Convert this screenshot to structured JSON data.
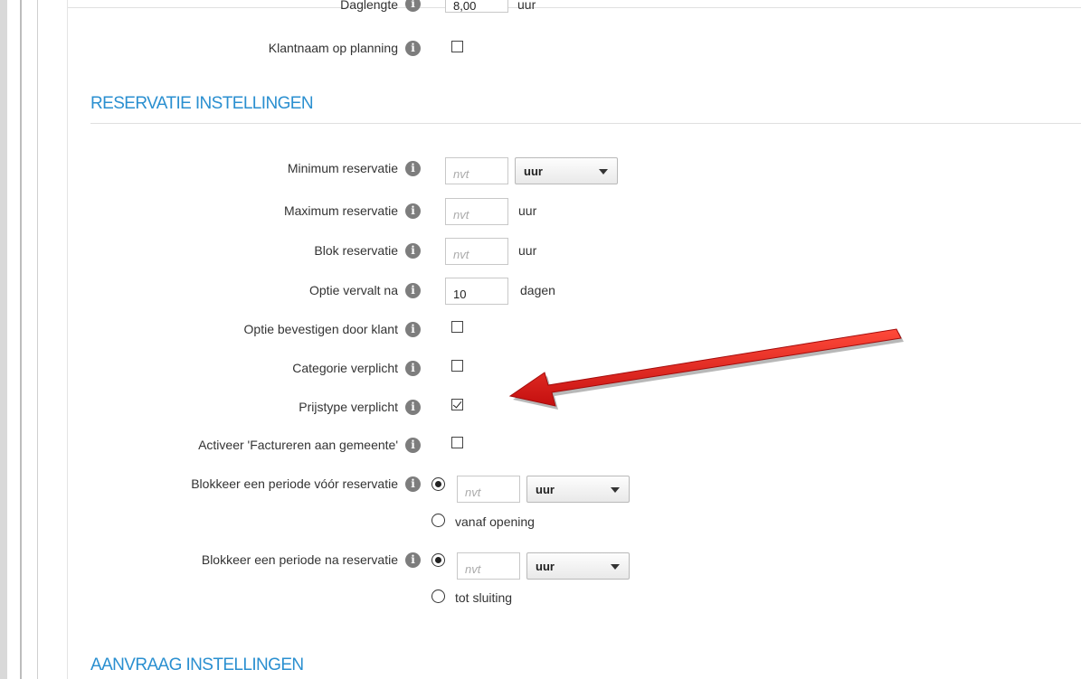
{
  "top": {
    "daglengte_label": "Daglengte",
    "daglengte_value": "8,00",
    "daglengte_unit": "uur",
    "klantnaam_label": "Klantnaam op planning"
  },
  "reservatie": {
    "title": "RESERVATIE INSTELLINGEN",
    "minimum": {
      "label": "Minimum reservatie",
      "placeholder": "nvt",
      "select": "uur"
    },
    "maximum": {
      "label": "Maximum reservatie",
      "placeholder": "nvt",
      "unit": "uur"
    },
    "blok": {
      "label": "Blok reservatie",
      "placeholder": "nvt",
      "unit": "uur"
    },
    "optie_vervalt": {
      "label": "Optie vervalt na",
      "value": "10",
      "unit": "dagen"
    },
    "optie_bevestigen": {
      "label": "Optie bevestigen door klant",
      "checked": false
    },
    "categorie": {
      "label": "Categorie verplicht",
      "checked": false
    },
    "prijstype": {
      "label": "Prijstype verplicht",
      "checked": true
    },
    "factureren": {
      "label": "Activeer 'Factureren aan gemeente'",
      "checked": false
    },
    "blokkeer_voor": {
      "label": "Blokkeer een periode vóór reservatie",
      "placeholder": "nvt",
      "select": "uur",
      "alt_option": "vanaf opening"
    },
    "blokkeer_na": {
      "label": "Blokkeer een periode na reservatie",
      "placeholder": "nvt",
      "select": "uur",
      "alt_option": "tot sluiting"
    }
  },
  "aanvraag": {
    "title": "AANVRAAG INSTELLINGEN"
  },
  "icons": {
    "info": "info-icon",
    "annotation": "red-arrow-annotation"
  },
  "colors": {
    "section_title": "#2a8fd0",
    "arrow": "#e11a1a"
  }
}
